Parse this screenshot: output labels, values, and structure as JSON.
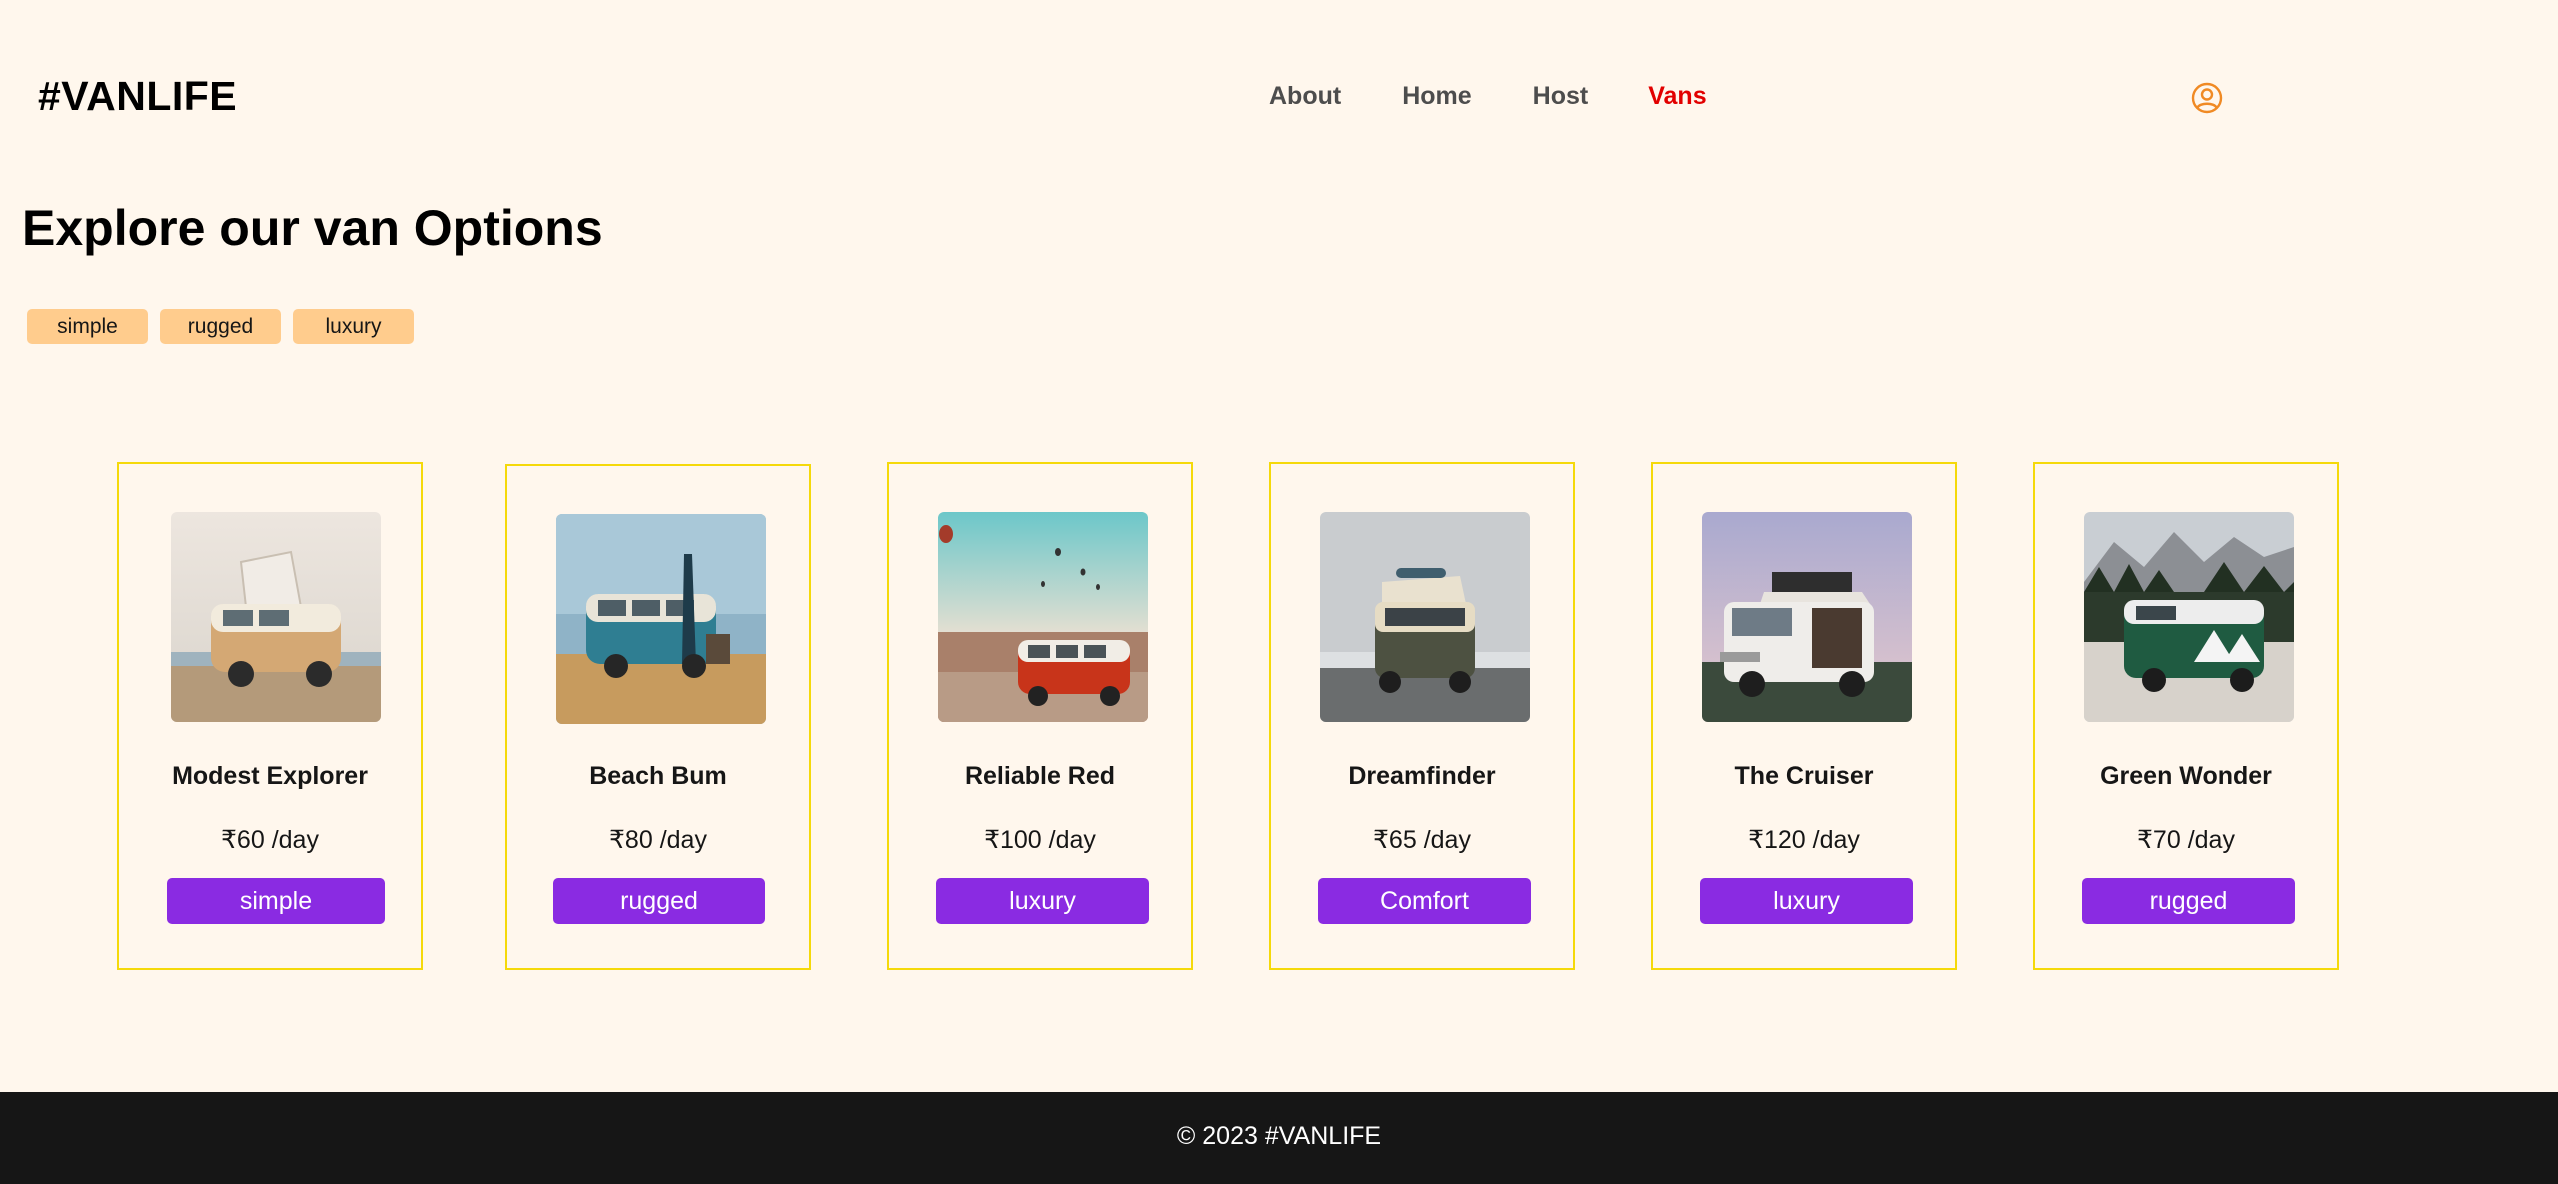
{
  "header": {
    "logo": "#VANLIFE",
    "nav": [
      {
        "label": "About",
        "active": false
      },
      {
        "label": "Home",
        "active": false
      },
      {
        "label": "Host",
        "active": false
      },
      {
        "label": "Vans",
        "active": true
      }
    ],
    "user_icon": "user-circle-icon",
    "active_color": "#E20000"
  },
  "main": {
    "title": "Explore our van Options",
    "filters": [
      "simple",
      "rugged",
      "luxury"
    ]
  },
  "vans": [
    {
      "name": "Modest Explorer",
      "price": "₹60 /day",
      "type": "simple",
      "image": "van-photo-icon"
    },
    {
      "name": "Beach Bum",
      "price": "₹80 /day",
      "type": "rugged",
      "image": "van-photo-icon"
    },
    {
      "name": "Reliable Red",
      "price": "₹100 /day",
      "type": "luxury",
      "image": "van-photo-icon"
    },
    {
      "name": "Dreamfinder",
      "price": "₹65 /day",
      "type": "Comfort",
      "image": "van-photo-icon"
    },
    {
      "name": "The Cruiser",
      "price": "₹120 /day",
      "type": "luxury",
      "image": "van-photo-icon"
    },
    {
      "name": "Green Wonder",
      "price": "₹70 /day",
      "type": "rugged",
      "image": "van-photo-icon"
    }
  ],
  "footer": {
    "text": "© 2023 #VANLIFE"
  },
  "colors": {
    "background": "#FFF7ED",
    "filter_bg": "#FFCC8D",
    "type_button": "#8A2BE2",
    "card_border": "#F5D90A",
    "footer_bg": "#161616"
  }
}
